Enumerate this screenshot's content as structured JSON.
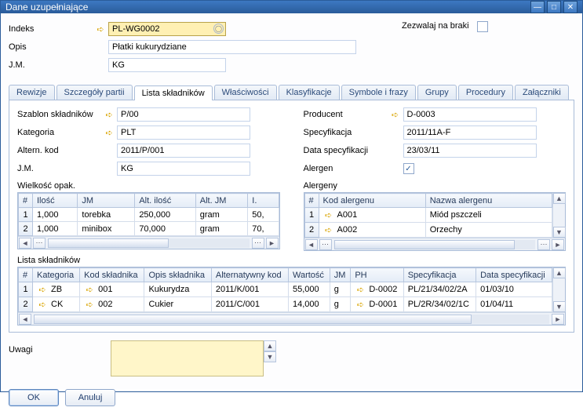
{
  "window": {
    "title": "Dane uzupełniające"
  },
  "top": {
    "labels": {
      "indeks": "Indeks",
      "opis": "Opis",
      "jm": "J.M.",
      "zezwalaj": "Zezwalaj na braki"
    },
    "indeks": "PL-WG0002",
    "opis": "Płatki kukurydziane",
    "jm": "KG",
    "zezwalaj_checked": false
  },
  "tabs": [
    "Rewizje",
    "Szczegóły partii",
    "Lista składników",
    "Właściwości",
    "Klasyfikacje",
    "Symbole i frazy",
    "Grupy",
    "Procedury",
    "Załączniki"
  ],
  "tab_active": 2,
  "left": {
    "labels": {
      "szablon": "Szablon składników",
      "kategoria": "Kategoria",
      "altkod": "Altern. kod",
      "jm": "J.M."
    },
    "szablon": "P/00",
    "kategoria": "PLT",
    "altkod": "2011/P/001",
    "jm": "KG"
  },
  "right": {
    "labels": {
      "producent": "Producent",
      "spec": "Specyfikacja",
      "dataspec": "Data specyfikacji",
      "alergen": "Alergen"
    },
    "producent": "D-0003",
    "spec": "2011/11A-F",
    "dataspec": "23/03/11",
    "alergen_checked": true
  },
  "opak": {
    "title": "Wielkość opak.",
    "cols": [
      "#",
      "Ilość",
      "JM",
      "Alt. ilość",
      "Alt. JM",
      "I."
    ],
    "rows": [
      {
        "n": "1",
        "ilosc": "1,000",
        "jm": "torebka",
        "altilosc": "250,000",
        "altjm": "gram",
        "i": "50,"
      },
      {
        "n": "2",
        "ilosc": "1,000",
        "jm": "minibox",
        "altilosc": "70,000",
        "altjm": "gram",
        "i": "70,"
      }
    ]
  },
  "alerg": {
    "title": "Alergeny",
    "cols": [
      "#",
      "Kod alergenu",
      "Nazwa alergenu"
    ],
    "rows": [
      {
        "n": "1",
        "kod": "A001",
        "nazwa": "Miód pszczeli"
      },
      {
        "n": "2",
        "kod": "A002",
        "nazwa": "Orzechy"
      }
    ]
  },
  "sklad": {
    "title": "Lista składników",
    "cols": [
      "#",
      "Kategoria",
      "Kod składnika",
      "Opis składnika",
      "Alternatywny kod",
      "Wartość",
      "JM",
      "PH",
      "Specyfikacja",
      "Data specyfikacji"
    ],
    "rows": [
      {
        "n": "1",
        "kat": "ZB",
        "kod": "001",
        "opis": "Kukurydza",
        "alt": "2011/K/001",
        "wart": "55,000",
        "jm": "g",
        "ph": "D-0002",
        "spec": "PL/21/34/02/2A",
        "data": "01/03/10"
      },
      {
        "n": "2",
        "kat": "CK",
        "kod": "002",
        "opis": "Cukier",
        "alt": "2011/C/001",
        "wart": "14,000",
        "jm": "g",
        "ph": "D-0001",
        "spec": "PL/2R/34/02/1C",
        "data": "01/04/11"
      }
    ]
  },
  "uwagi": {
    "label": "Uwagi",
    "value": ""
  },
  "buttons": {
    "ok": "OK",
    "anuluj": "Anuluj"
  }
}
